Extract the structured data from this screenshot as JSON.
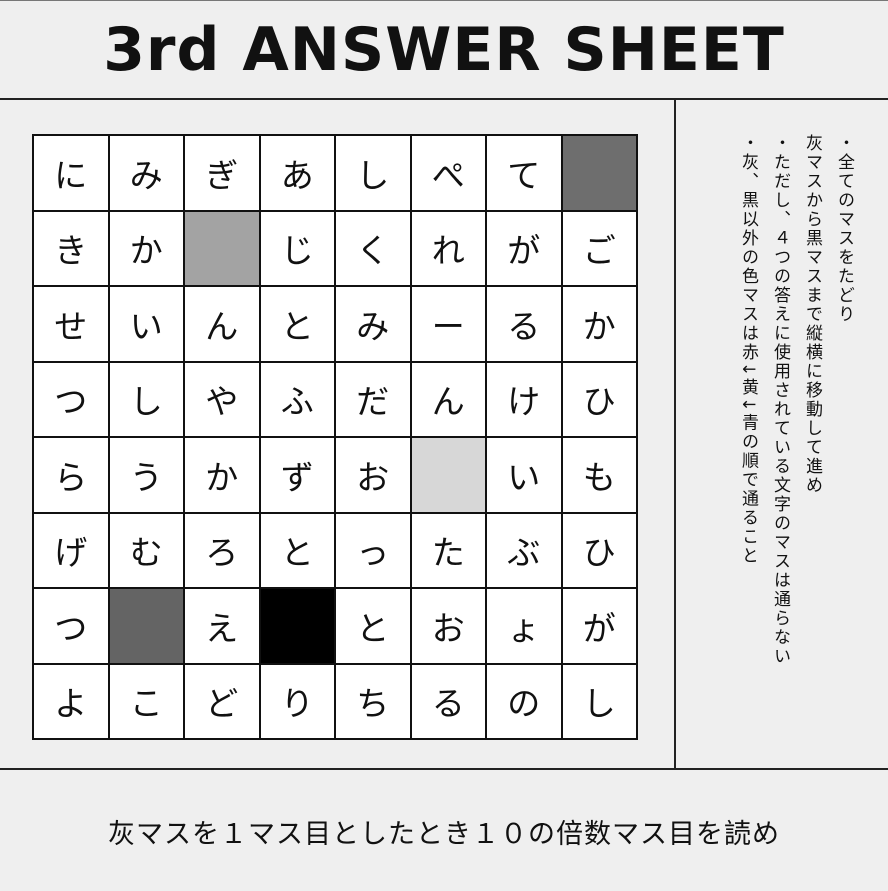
{
  "header": {
    "title": "3rd ANSWER SHEET"
  },
  "grid": {
    "rows": [
      [
        {
          "t": "に"
        },
        {
          "t": "み"
        },
        {
          "t": "ぎ"
        },
        {
          "t": "あ"
        },
        {
          "t": "し"
        },
        {
          "t": "ぺ"
        },
        {
          "t": "て"
        },
        {
          "t": "",
          "fill": "#6e6e6e"
        }
      ],
      [
        {
          "t": "き"
        },
        {
          "t": "か"
        },
        {
          "t": "",
          "fill": "#a3a3a3"
        },
        {
          "t": "じ"
        },
        {
          "t": "く"
        },
        {
          "t": "れ"
        },
        {
          "t": "が"
        },
        {
          "t": "ご"
        }
      ],
      [
        {
          "t": "せ"
        },
        {
          "t": "い"
        },
        {
          "t": "ん"
        },
        {
          "t": "と"
        },
        {
          "t": "み"
        },
        {
          "t": "ー"
        },
        {
          "t": "る"
        },
        {
          "t": "か"
        }
      ],
      [
        {
          "t": "つ"
        },
        {
          "t": "し"
        },
        {
          "t": "や"
        },
        {
          "t": "ふ"
        },
        {
          "t": "だ"
        },
        {
          "t": "ん"
        },
        {
          "t": "け"
        },
        {
          "t": "ひ"
        }
      ],
      [
        {
          "t": "ら"
        },
        {
          "t": "う"
        },
        {
          "t": "か"
        },
        {
          "t": "ず"
        },
        {
          "t": "お"
        },
        {
          "t": "",
          "fill": "#d7d7d7"
        },
        {
          "t": "い"
        },
        {
          "t": "も"
        }
      ],
      [
        {
          "t": "げ"
        },
        {
          "t": "む"
        },
        {
          "t": "ろ"
        },
        {
          "t": "と"
        },
        {
          "t": "っ"
        },
        {
          "t": "た"
        },
        {
          "t": "ぶ"
        },
        {
          "t": "ひ"
        }
      ],
      [
        {
          "t": "つ"
        },
        {
          "t": "",
          "fill": "#646464"
        },
        {
          "t": "え"
        },
        {
          "t": "",
          "fill": "#000000"
        },
        {
          "t": "と"
        },
        {
          "t": "お"
        },
        {
          "t": "ょ"
        },
        {
          "t": "が"
        }
      ],
      [
        {
          "t": "よ"
        },
        {
          "t": "こ"
        },
        {
          "t": "ど"
        },
        {
          "t": "り"
        },
        {
          "t": "ち"
        },
        {
          "t": "る"
        },
        {
          "t": "の"
        },
        {
          "t": "し"
        }
      ]
    ]
  },
  "notes": {
    "line1": "・全てのマスをたどり",
    "line2": "灰マスから黒マスまで縦横に移動して進め",
    "line3": "・ただし、４つの答えに使用されている文字のマスは通らない",
    "line4": "・灰、黒以外の色マスは赤↓黄↓青の順で通ること"
  },
  "footer": {
    "instruction": "灰マスを１マス目としたとき１０の倍数マス目を読め"
  }
}
